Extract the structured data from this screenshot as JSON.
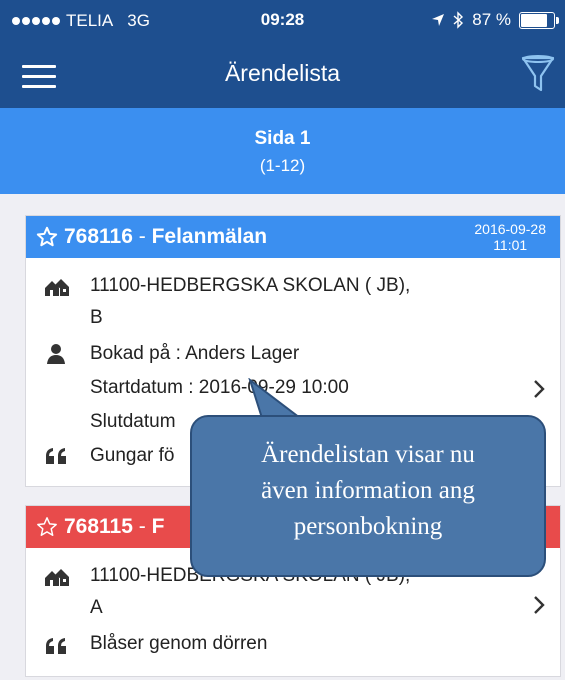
{
  "status_bar": {
    "carrier": "TELIA",
    "network": "3G",
    "time": "09:28",
    "battery": "87 %",
    "battery_level": 0.87
  },
  "navbar": {
    "title": "Ärendelista",
    "menu_icon": "hamburger-menu-icon",
    "filter_icon": "funnel-filter-icon"
  },
  "pager": {
    "page": "Sida 1",
    "range": "(1-12)"
  },
  "cases": [
    {
      "number": "768116",
      "separator": " - ",
      "type": "Felanmälan",
      "date": "2016-09-28",
      "time": "11:01",
      "header_color": "#3b8ff0",
      "address_line1": "11100-HEDBERGSKA SKOLAN ( JB),",
      "address_line2": "B",
      "booked_by": "Bokad på : Anders Lager",
      "start": "Startdatum : 2016-09-29 10:00",
      "end": "Slutdatum",
      "comment": "Gungar fö"
    },
    {
      "number": "768115",
      "separator": " - ",
      "type": "F",
      "header_color": "#e84b4b",
      "address_line1": "11100-HEDBERGSKA SKOLAN ( JB),",
      "address_line2": "A",
      "comment": "Blåser genom dörren"
    }
  ],
  "callout": {
    "line1": "Ärendelistan visar nu",
    "line2": "även information ang",
    "line3": "personbokning"
  }
}
